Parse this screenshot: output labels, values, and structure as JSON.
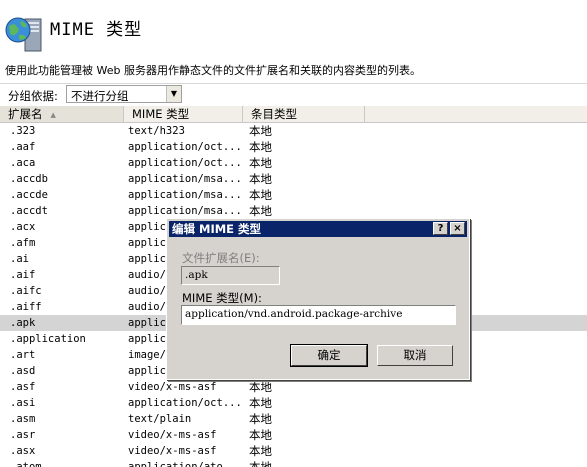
{
  "header": {
    "title": "MIME 类型",
    "description": "使用此功能管理被 Web 服务器用作静态文件的文件扩展名和关联的内容类型的列表。"
  },
  "group_by": {
    "label": "分组依据:",
    "selected": "不进行分组"
  },
  "table": {
    "columns": [
      "扩展名",
      "MIME 类型",
      "条目类型"
    ],
    "sorted_column": "扩展名",
    "selected_row": ".apk",
    "rows": [
      {
        "ext": ".323",
        "mime": "text/h323",
        "type": "本地"
      },
      {
        "ext": ".aaf",
        "mime": "application/oct...",
        "type": "本地"
      },
      {
        "ext": ".aca",
        "mime": "application/oct...",
        "type": "本地"
      },
      {
        "ext": ".accdb",
        "mime": "application/msa...",
        "type": "本地"
      },
      {
        "ext": ".accde",
        "mime": "application/msa...",
        "type": "本地"
      },
      {
        "ext": ".accdt",
        "mime": "application/msa...",
        "type": "本地"
      },
      {
        "ext": ".acx",
        "mime": "applic",
        "type": ""
      },
      {
        "ext": ".afm",
        "mime": "applic",
        "type": ""
      },
      {
        "ext": ".ai",
        "mime": "applic",
        "type": ""
      },
      {
        "ext": ".aif",
        "mime": "audio/",
        "type": ""
      },
      {
        "ext": ".aifc",
        "mime": "audio/",
        "type": ""
      },
      {
        "ext": ".aiff",
        "mime": "audio/",
        "type": ""
      },
      {
        "ext": ".apk",
        "mime": "applic",
        "type": ""
      },
      {
        "ext": ".application",
        "mime": "applic",
        "type": ""
      },
      {
        "ext": ".art",
        "mime": "image/",
        "type": ""
      },
      {
        "ext": ".asd",
        "mime": "applic",
        "type": ""
      },
      {
        "ext": ".asf",
        "mime": "video/x-ms-asf",
        "type": "本地"
      },
      {
        "ext": ".asi",
        "mime": "application/oct...",
        "type": "本地"
      },
      {
        "ext": ".asm",
        "mime": "text/plain",
        "type": "本地"
      },
      {
        "ext": ".asr",
        "mime": "video/x-ms-asf",
        "type": "本地"
      },
      {
        "ext": ".asx",
        "mime": "video/x-ms-asf",
        "type": "本地"
      },
      {
        "ext": ".atom",
        "mime": "application/ato...",
        "type": "本地"
      }
    ]
  },
  "dialog": {
    "title": "编辑 MIME 类型",
    "help_button": "?",
    "close_button": "×",
    "ext_label": "文件扩展名(E):",
    "ext_value": ".apk",
    "mime_label": "MIME 类型(M):",
    "mime_value": "application/vnd.android.package-archive",
    "ok_label": "确定",
    "cancel_label": "取消"
  }
}
